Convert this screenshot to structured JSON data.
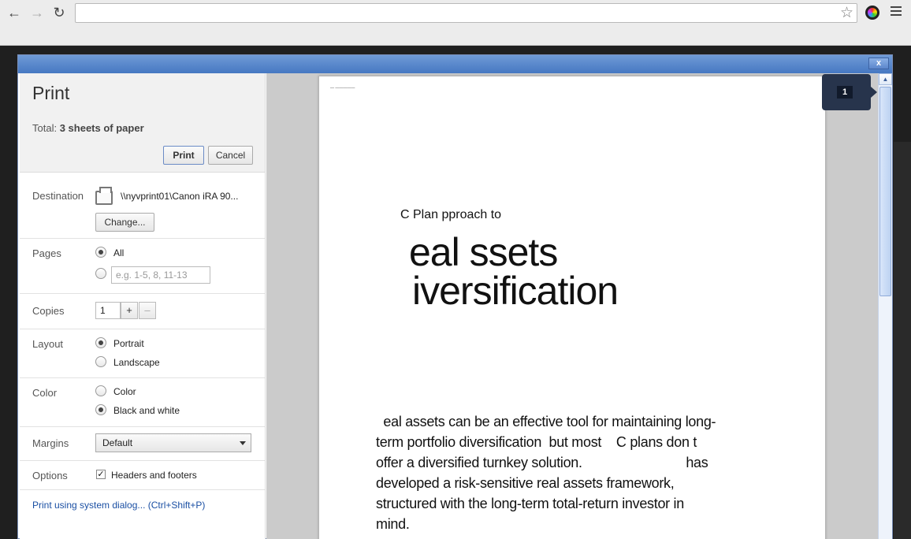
{
  "browser": {
    "back_icon": "back-arrow-icon",
    "forward_icon": "forward-arrow-icon",
    "reload_icon": "reload-icon",
    "address": "",
    "star_icon": "star-icon",
    "menu_icon": "hamburger-menu-icon"
  },
  "dialog": {
    "close_label": "x",
    "title": "Print",
    "total_prefix": "Total:",
    "total_value": "3 sheets of paper",
    "print_label": "Print",
    "cancel_label": "Cancel"
  },
  "settings": {
    "destination": {
      "label": "Destination",
      "printer": "\\\\nyvprint01\\Canon iRA 90...",
      "change_label": "Change..."
    },
    "pages": {
      "label": "Pages",
      "all_label": "All",
      "range_placeholder": "e.g. 1-5, 8, 11-13"
    },
    "copies": {
      "label": "Copies",
      "value": "1",
      "plus": "+",
      "minus": "–"
    },
    "layout": {
      "label": "Layout",
      "portrait": "Portrait",
      "landscape": "Landscape"
    },
    "color": {
      "label": "Color",
      "color": "Color",
      "bw": "Black and white"
    },
    "margins": {
      "label": "Margins",
      "value": "Default"
    },
    "options": {
      "label": "Options",
      "headers_footers": "Headers and footers",
      "checkmark": "✓"
    },
    "system_dialog_link": "Print using system dialog... (Ctrl+Shift+P)"
  },
  "preview": {
    "header_text": "—  —————",
    "subtitle": "C Plan   pproach to",
    "title_line1": "eal     ssets",
    "title_line2": "iversification",
    "body_lines": [
      "  eal assets can be an effective tool for maintaining long-",
      "term portfolio diversification  but most    C plans don t",
      "offer a diversified turnkey solution.                            has",
      "developed a risk-sensitive real assets framework,",
      "structured with the long-term total-return investor in",
      "mind."
    ],
    "page_number": "1",
    "scroll_up": "▲"
  },
  "colors": {
    "titlebar": "#4678c2",
    "link": "#1a4fa3",
    "page_badge": "#27344c"
  }
}
